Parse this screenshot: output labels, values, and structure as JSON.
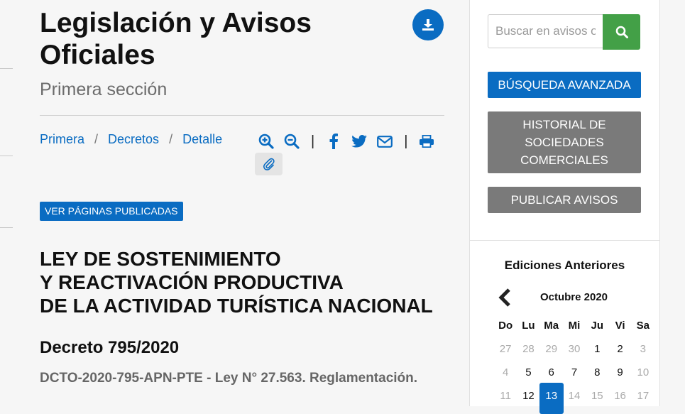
{
  "header": {
    "title_line1": "Legislación y Avisos",
    "title_line2": "Oficiales",
    "subtitle": "Primera sección"
  },
  "breadcrumb": [
    "Primera",
    "Decretos",
    "Detalle"
  ],
  "breadcrumb_separator": "/",
  "toolbar": {
    "icons": [
      "zoom-in-icon",
      "zoom-out-icon",
      "facebook-icon",
      "twitter-icon",
      "email-icon",
      "print-icon",
      "paperclip-icon",
      "download-icon"
    ],
    "separator": "|"
  },
  "pages_button_label": "VER PÁGINAS PUBLICADAS",
  "law_title": [
    "LEY DE SOSTENIMIENTO",
    "Y REACTIVACIÓN PRODUCTIVA",
    "DE LA ACTIVIDAD TURÍSTICA NACIONAL"
  ],
  "decree": "Decreto 795/2020",
  "summary": "DCTO-2020-795-APN-PTE - Ley N° 27.563. Reglamentación.",
  "sidebar": {
    "search_placeholder": "Buscar en avisos oficiales",
    "advanced_search_label": "BÚSQUEDA AVANZADA",
    "history_label": "HISTORIAL DE SOCIEDADES COMERCIALES",
    "publish_label": "PUBLICAR AVISOS",
    "editions_title": "Ediciones Anteriores"
  },
  "calendar": {
    "month": "Octubre 2020",
    "weekdays": [
      "Do",
      "Lu",
      "Ma",
      "Mi",
      "Ju",
      "Vi",
      "Sa"
    ],
    "days": [
      {
        "label": "27",
        "muted": true
      },
      {
        "label": "28",
        "muted": true
      },
      {
        "label": "29",
        "muted": true
      },
      {
        "label": "30",
        "muted": true
      },
      {
        "label": "1",
        "muted": false
      },
      {
        "label": "2",
        "muted": false
      },
      {
        "label": "3",
        "muted": true
      },
      {
        "label": "4",
        "muted": true
      },
      {
        "label": "5",
        "muted": false
      },
      {
        "label": "6",
        "muted": false
      },
      {
        "label": "7",
        "muted": false
      },
      {
        "label": "8",
        "muted": false
      },
      {
        "label": "9",
        "muted": false
      },
      {
        "label": "10",
        "muted": true
      },
      {
        "label": "11",
        "muted": true
      },
      {
        "label": "12",
        "muted": false
      },
      {
        "label": "13",
        "muted": false,
        "selected": true
      },
      {
        "label": "14",
        "muted": true
      },
      {
        "label": "15",
        "muted": true
      },
      {
        "label": "16",
        "muted": true
      },
      {
        "label": "17",
        "muted": true
      }
    ]
  },
  "colors": {
    "primary": "#0a6cc2",
    "search_button": "#43a047",
    "secondary_button": "#7a7a7a"
  }
}
